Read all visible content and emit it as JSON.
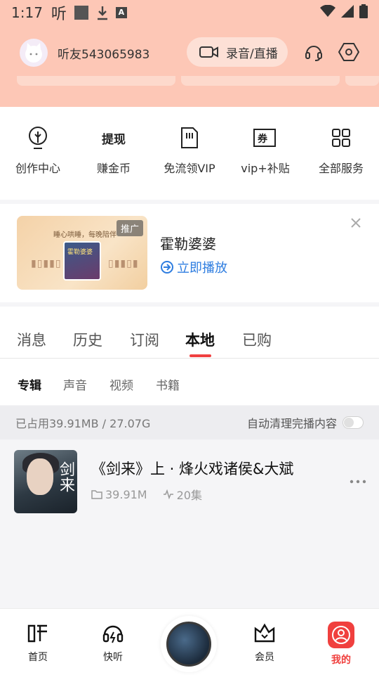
{
  "status_bar": {
    "time": "1:17",
    "listen_glyph": "听",
    "a_glyph": "A"
  },
  "header": {
    "username": "听友543065983",
    "record_label": "录音/直播"
  },
  "quick_actions": [
    {
      "label": "创作中心",
      "icon": "creator-bulb-icon"
    },
    {
      "label": "赚金币",
      "icon": "withdraw-icon",
      "icon_text": "提现"
    },
    {
      "label": "免流领VIP",
      "icon": "sim-card-icon"
    },
    {
      "label": "vip+补贴",
      "icon": "coupon-icon",
      "icon_text": "券"
    },
    {
      "label": "全部服务",
      "icon": "grid-icon"
    }
  ],
  "promo": {
    "tag": "推广",
    "image_subtitle": "睡心哄睡，每晚陪伴",
    "image_book_title": "霍勒婆婆",
    "title": "霍勒婆婆",
    "play_label": "立即播放"
  },
  "main_tabs": [
    {
      "label": "消息",
      "active": false
    },
    {
      "label": "历史",
      "active": false
    },
    {
      "label": "订阅",
      "active": false
    },
    {
      "label": "本地",
      "active": true
    },
    {
      "label": "已购",
      "active": false
    }
  ],
  "sub_tabs": [
    {
      "label": "专辑",
      "active": true
    },
    {
      "label": "声音",
      "active": false
    },
    {
      "label": "视频",
      "active": false
    },
    {
      "label": "书籍",
      "active": false
    }
  ],
  "storage": {
    "used_text": "已占用39.91MB / 27.07G",
    "auto_clean_label": "自动清理完播内容",
    "auto_clean_on": false
  },
  "albums": [
    {
      "title": "《剑来》上 · 烽火戏诸侯&大斌",
      "size": "39.91M",
      "episodes": "20集",
      "cover_text": "剑来"
    }
  ],
  "bottom_nav": [
    {
      "label": "首页",
      "icon": "home-listen-icon"
    },
    {
      "label": "快听",
      "icon": "headphones-icon"
    },
    {
      "label": "会员",
      "icon": "vip-crown-icon"
    },
    {
      "label": "我的",
      "icon": "profile-icon",
      "active": true
    }
  ],
  "colors": {
    "header_bg": "#fdc7b6",
    "accent_red": "#f0403e",
    "link_blue": "#2e7de0"
  }
}
